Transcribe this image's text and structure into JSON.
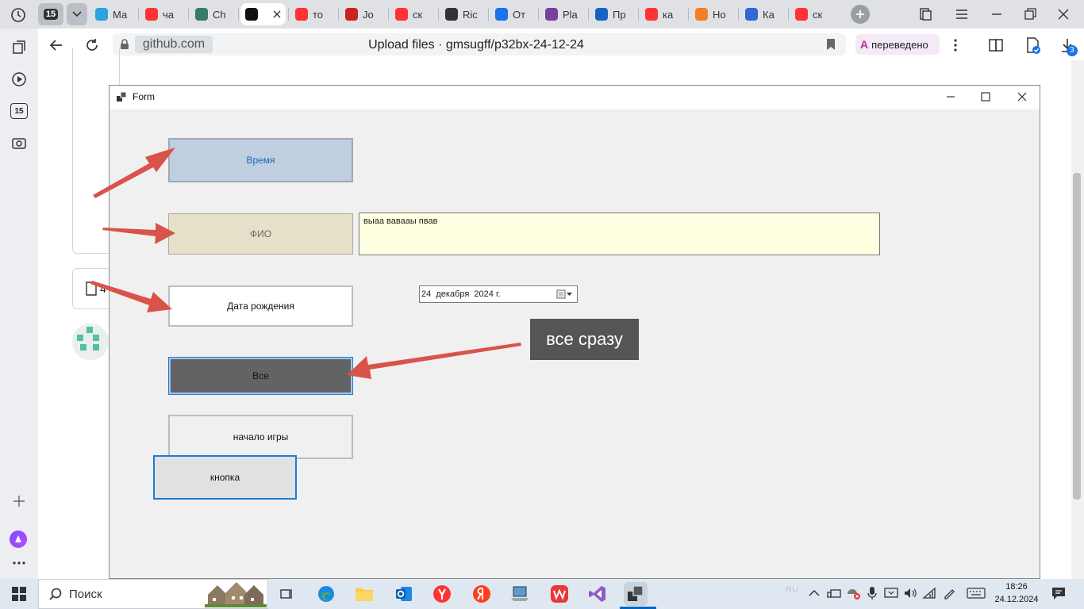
{
  "browser": {
    "tab_counter": "15",
    "tabs": [
      {
        "label": "Ма",
        "favicon": "telegram-icon",
        "color": "#2aa3df"
      },
      {
        "label": "ча",
        "favicon": "yandex-icon",
        "color": "#f33"
      },
      {
        "label": "Ch",
        "favicon": "chatgpt-icon",
        "color": "#3a7a6a"
      },
      {
        "label": "",
        "favicon": "github-icon",
        "color": "#111",
        "active": true
      },
      {
        "label": "то",
        "favicon": "yandex-icon",
        "color": "#f33"
      },
      {
        "label": "Jo",
        "favicon": "jo-icon",
        "color": "#c22"
      },
      {
        "label": "ск",
        "favicon": "yandex-icon",
        "color": "#f33"
      },
      {
        "label": "Ric",
        "favicon": "museum-icon",
        "color": "#333"
      },
      {
        "label": "От",
        "favicon": "question-icon",
        "color": "#1a73e8"
      },
      {
        "label": "Pla",
        "favicon": "play-icon",
        "color": "#7b3fa0"
      },
      {
        "label": "Пр",
        "favicon": "e-icon",
        "color": "#1565c0"
      },
      {
        "label": "ка",
        "favicon": "yandex-icon",
        "color": "#f33"
      },
      {
        "label": "Но",
        "favicon": "stackoverflow-icon",
        "color": "#f48024"
      },
      {
        "label": "Ка",
        "favicon": "puzzle-icon",
        "color": "#3367d6"
      },
      {
        "label": "ск",
        "favicon": "yandex-icon",
        "color": "#f33"
      }
    ],
    "domain": "github.com",
    "page_title": "Upload files · gmsugff/p32bx-24-12-24",
    "translate_label": "переведено",
    "downloads_badge": "3"
  },
  "sidebar_rail": {
    "counter": "15"
  },
  "page_bg": {
    "partial_text": "4"
  },
  "form": {
    "title": "Form",
    "buttons": {
      "time": "Время",
      "fio": "ФИО",
      "birth": "Дата рождения",
      "all": "Все",
      "start_game": "начало игры",
      "button": "кнопка"
    },
    "fio_text": "выаа вавааы пвав",
    "date_value": "24  декабря  2024 г.",
    "annotation": "все сразу"
  },
  "taskbar": {
    "search_label": "Поиск",
    "tray_lang": "RU",
    "time": "18:26",
    "date": "24.12.2024"
  },
  "colors": {
    "time_button_bg": "#c0cfe0",
    "fio_button_bg": "#e6e0c8",
    "all_button_bg": "#636363",
    "textbox_bg": "#ffffe1",
    "arrow_red": "#d9534a",
    "annotation_bg": "#555555",
    "focus_blue": "#0078d7"
  }
}
